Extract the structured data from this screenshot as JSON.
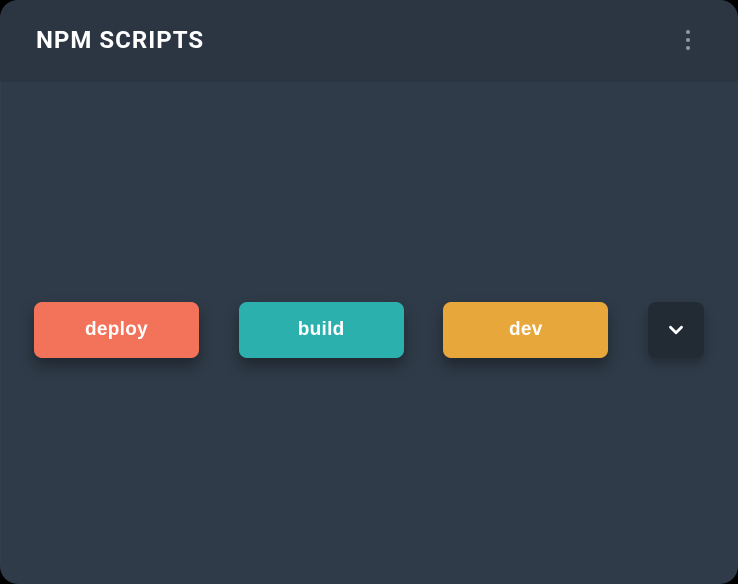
{
  "header": {
    "title": "NPM SCRIPTS"
  },
  "scripts": [
    {
      "label": "deploy",
      "color": "#f2725a"
    },
    {
      "label": "build",
      "color": "#2cb0ad"
    },
    {
      "label": "dev",
      "color": "#e8a73b"
    }
  ],
  "icons": {
    "more_vertical": "more-vertical-icon",
    "chevron_down": "chevron-down-icon"
  }
}
